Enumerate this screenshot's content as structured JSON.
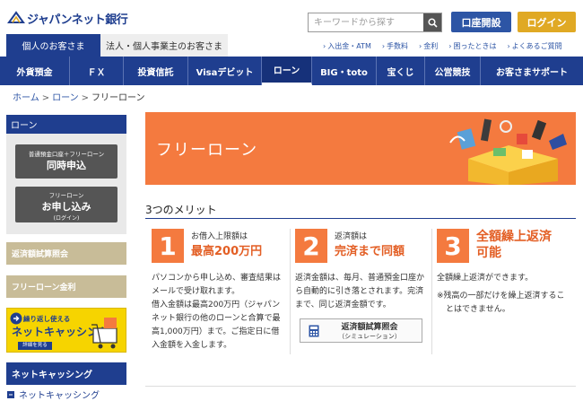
{
  "header": {
    "logo_text": "ジャパンネット銀行",
    "search_placeholder": "キーワードから探す",
    "open_account": "口座開設",
    "login": "ログイン",
    "tab_personal": "個人のお客さま",
    "tab_business": "法人・個人事業主のお客さま",
    "util_links": [
      "入出金・ATM",
      "手数料",
      "金利",
      "困ったときは",
      "よくあるご質問"
    ]
  },
  "nav": {
    "items": [
      "外貨預金",
      "ＦＸ",
      "投資信託",
      "Visaデビット",
      "ローン",
      "BIG・toto",
      "宝くじ",
      "公営競技",
      "お客さまサポート"
    ],
    "active": "ローン"
  },
  "breadcrumb": [
    "ホーム",
    "ローン",
    "フリーローン"
  ],
  "sidebar": {
    "loan_head": "ローン",
    "btn1_small": "普通預金口座＋フリーローン",
    "btn1_big": "同時申込",
    "btn2_small": "フリーローン",
    "btn2_big": "お申し込み",
    "btn2_tiny": "(ログイン)",
    "shisan": "返済額試算照会",
    "kinri": "フリーローン金利",
    "banner_t1": "繰り返し使える",
    "banner_t2": "ネットキャッシング",
    "banner_t3": "詳細を見る",
    "netcash_head": "ネットキャッシング",
    "netcash_link": "ネットキャッシング"
  },
  "hero": {
    "title": "フリーローン"
  },
  "merits": {
    "heading": "3つのメリット",
    "m1": {
      "num": "1",
      "sub": "お借入上限額は",
      "main": "最高200万円",
      "body": [
        "パソコンから申し込め、審査結果は",
        "メールで受け取れます。",
        "借入金額は最高200万円（ジャパン",
        "ネット銀行の他のローンと合算で最",
        "高1,000万円）まで。ご指定日に借",
        "入金額を入金します。"
      ]
    },
    "m2": {
      "num": "2",
      "sub": "返済額は",
      "main": "完済まで同額",
      "body": [
        "返済金額は、毎月、普通預金口座か",
        "ら自動的に引き落とされます。完済",
        "まで、同じ返済金額です。"
      ],
      "btn_a": "返済額試算照会",
      "btn_b": "（シミュレーション）"
    },
    "m3": {
      "num": "3",
      "main_l1": "全額繰上返済",
      "main_l2": "可能",
      "body": [
        "全額繰上返済ができます。"
      ],
      "note1": "※残高の一部だけを繰上返済するこ",
      "note2": "とはできません。"
    }
  }
}
